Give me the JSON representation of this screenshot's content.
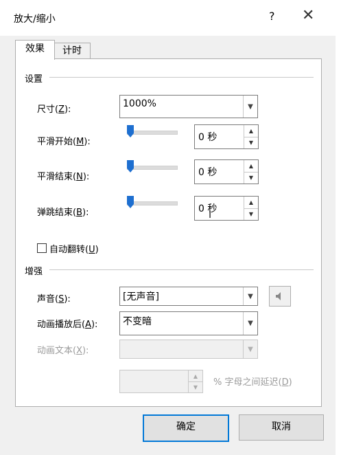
{
  "window": {
    "title": "放大/缩小",
    "help": "?",
    "close": "✕"
  },
  "tabs": [
    {
      "label": "效果",
      "active": true
    },
    {
      "label": "计时",
      "active": false
    }
  ],
  "settings": {
    "section": "设置",
    "size": {
      "label": "尺寸(",
      "key": "Z",
      "suffix": "):",
      "value": "1000%"
    },
    "smooth_start": {
      "label": "平滑开始(",
      "key": "M",
      "suffix": "):",
      "value": "0 秒",
      "slider_fraction": 0
    },
    "smooth_end": {
      "label": "平滑结束(",
      "key": "N",
      "suffix": "):",
      "value": "0 秒",
      "slider_fraction": 0
    },
    "bounce_end": {
      "label": "弹跳结束(",
      "key": "B",
      "suffix": "):",
      "value": "0 秒",
      "slider_fraction": 0
    },
    "auto_reverse": {
      "label": "自动翻转(",
      "key": "U",
      "suffix": ")",
      "checked": false
    }
  },
  "enhance": {
    "section": "增强",
    "sound": {
      "label": "声音(",
      "key": "S",
      "suffix": "):",
      "value": "[无声音]"
    },
    "after_anim": {
      "label": "动画播放后(",
      "key": "A",
      "suffix": "):",
      "value": "不变暗"
    },
    "anim_text": {
      "label": "动画文本(",
      "key": "X",
      "suffix": "):",
      "value": ""
    },
    "delay": {
      "value": "",
      "label": "% 字母之间延迟(",
      "key": "D",
      "suffix": ")"
    }
  },
  "buttons": {
    "ok": "确定",
    "cancel": "取消"
  },
  "colors": {
    "slider_thumb": "#1e6fd0",
    "default_button_border": "#0078d7"
  }
}
